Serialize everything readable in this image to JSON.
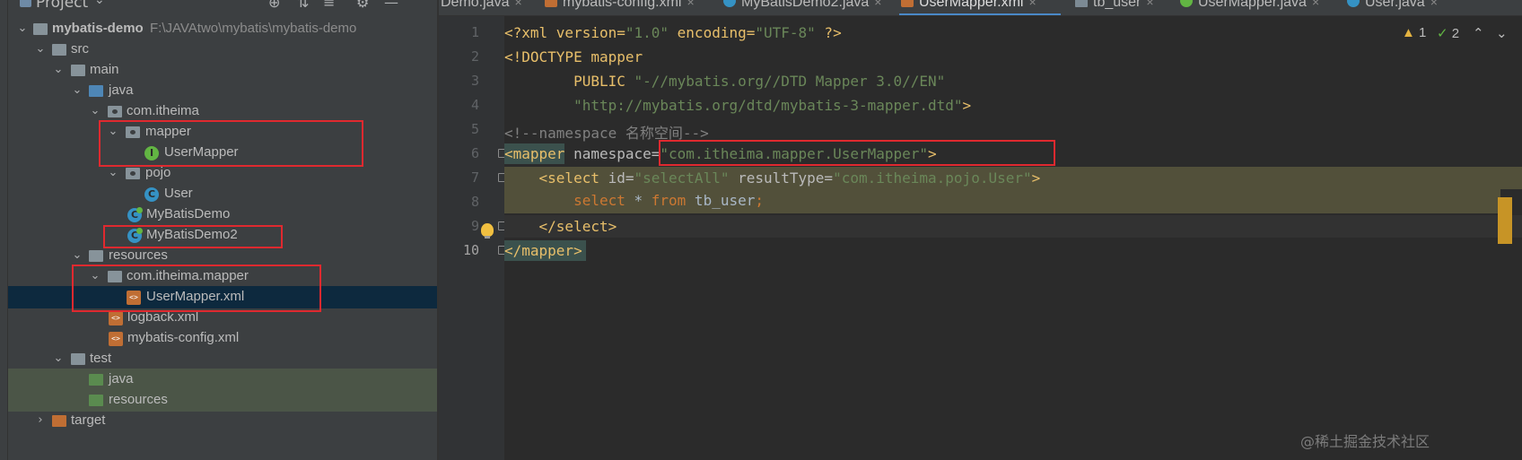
{
  "project_panel": {
    "title": "Project",
    "tree": [
      {
        "label": "mybatis-demo",
        "path": "F:\\JAVAtwo\\mybatis\\mybatis-demo"
      },
      {
        "label": "src"
      },
      {
        "label": "main"
      },
      {
        "label": "java"
      },
      {
        "label": "com.itheima"
      },
      {
        "label": "mapper"
      },
      {
        "label": "UserMapper"
      },
      {
        "label": "pojo"
      },
      {
        "label": "User"
      },
      {
        "label": "MyBatisDemo"
      },
      {
        "label": "MyBatisDemo2"
      },
      {
        "label": "resources"
      },
      {
        "label": "com.itheima.mapper"
      },
      {
        "label": "UserMapper.xml"
      },
      {
        "label": "logback.xml"
      },
      {
        "label": "mybatis-config.xml"
      },
      {
        "label": "test"
      },
      {
        "label": "java"
      },
      {
        "label": "resources"
      },
      {
        "label": "target"
      }
    ]
  },
  "tabs": [
    {
      "label": "Demo.java",
      "icon": "class-icon"
    },
    {
      "label": "mybatis-config.xml",
      "icon": "xml-icon"
    },
    {
      "label": "MyBatisDemo2.java",
      "icon": "class-icon"
    },
    {
      "label": "UserMapper.xml",
      "icon": "xml-icon",
      "active": true
    },
    {
      "label": "tb_user",
      "icon": "table-icon"
    },
    {
      "label": "UserMapper.java",
      "icon": "interface-icon"
    },
    {
      "label": "User.java",
      "icon": "class-icon"
    }
  ],
  "inspections": {
    "warnings": "1",
    "ok": "2"
  },
  "editor": {
    "line_numbers": [
      "1",
      "2",
      "3",
      "4",
      "5",
      "6",
      "7",
      "8",
      "9",
      "10"
    ],
    "lines": {
      "l1": {
        "a": "<?xml version=",
        "b": "\"1.0\"",
        "c": " encoding=",
        "d": "\"UTF-8\"",
        "e": " ?>"
      },
      "l2": {
        "a": "<!DOCTYPE mapper"
      },
      "l3": {
        "a": "        PUBLIC ",
        "b": "\"-//mybatis.org//DTD Mapper 3.0//EN\""
      },
      "l4": {
        "a": "        ",
        "b": "\"http://mybatis.org/dtd/mybatis-3-mapper.dtd\"",
        "c": ">"
      },
      "l5": {
        "a": "<!--namespace 名称空间-->"
      },
      "l6": {
        "a": "<mapper",
        "b": " namespace=",
        "c": "\"com.itheima.mapper.UserMapper\"",
        "d": ">"
      },
      "l7": {
        "a": "    <select",
        "b": " id=",
        "c": "\"selectAll\"",
        "d": " resultType=",
        "e": "\"com.itheima.pojo.User\"",
        "f": ">"
      },
      "l8": {
        "a": "        ",
        "b": "select",
        "c": " * ",
        "d": "from",
        "e": " tb_user",
        "f": ";"
      },
      "l9": {
        "a": "    </select>"
      },
      "l10": {
        "a": "</mapper>"
      }
    }
  },
  "watermark": "@稀土掘金技术社区",
  "colors": {
    "red_box": "#e0292f",
    "accent": "#4a88c7"
  }
}
